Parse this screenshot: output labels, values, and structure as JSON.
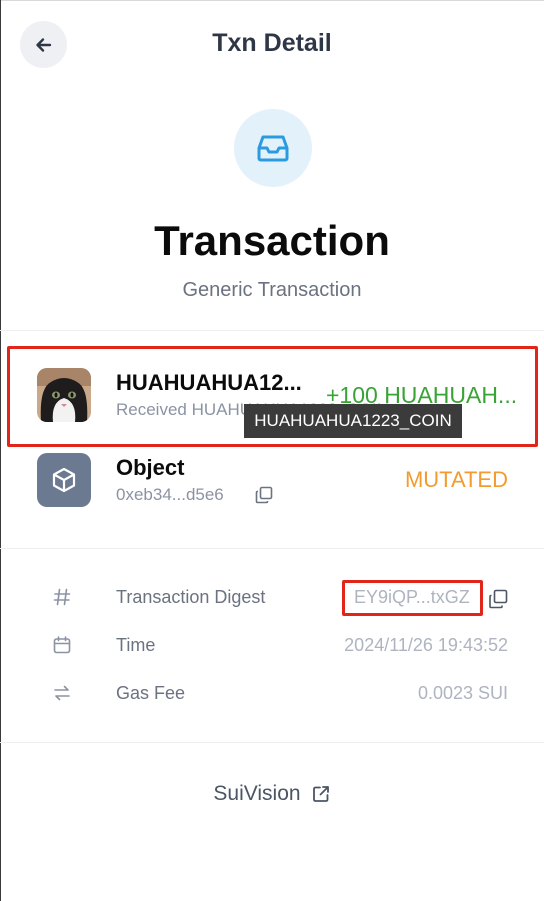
{
  "header": {
    "title": "Txn Detail",
    "back_icon": "arrow-left-icon"
  },
  "hero": {
    "icon": "inbox-icon",
    "title": "Transaction",
    "subtitle": "Generic Transaction"
  },
  "balance_change": {
    "name": "HUAHUAHUA12...",
    "subtitle": "Received HUAHUAHUA1223_COIN",
    "amount": "+100 HUAHUAH...",
    "tooltip": "HUAHUAHUA1223_COIN"
  },
  "object_change": {
    "icon": "cube-icon",
    "title": "Object",
    "id": "0xeb34...d5e6",
    "status": "MUTATED"
  },
  "details": [
    {
      "icon": "hash-icon",
      "label": "Transaction Digest",
      "value": "EY9iQP...txGZ"
    },
    {
      "icon": "calendar-icon",
      "label": "Time",
      "value": "2024/11/26 19:43:52"
    },
    {
      "icon": "swap-icon",
      "label": "Gas Fee",
      "value": "0.0023 SUI"
    }
  ],
  "footer": {
    "link_label": "SuiVision",
    "link_icon": "external-link-icon"
  },
  "colors": {
    "positive": "#3aa336",
    "mutated": "#f39b2e",
    "highlight": "#e0251b",
    "accent": "#2b9be0"
  }
}
